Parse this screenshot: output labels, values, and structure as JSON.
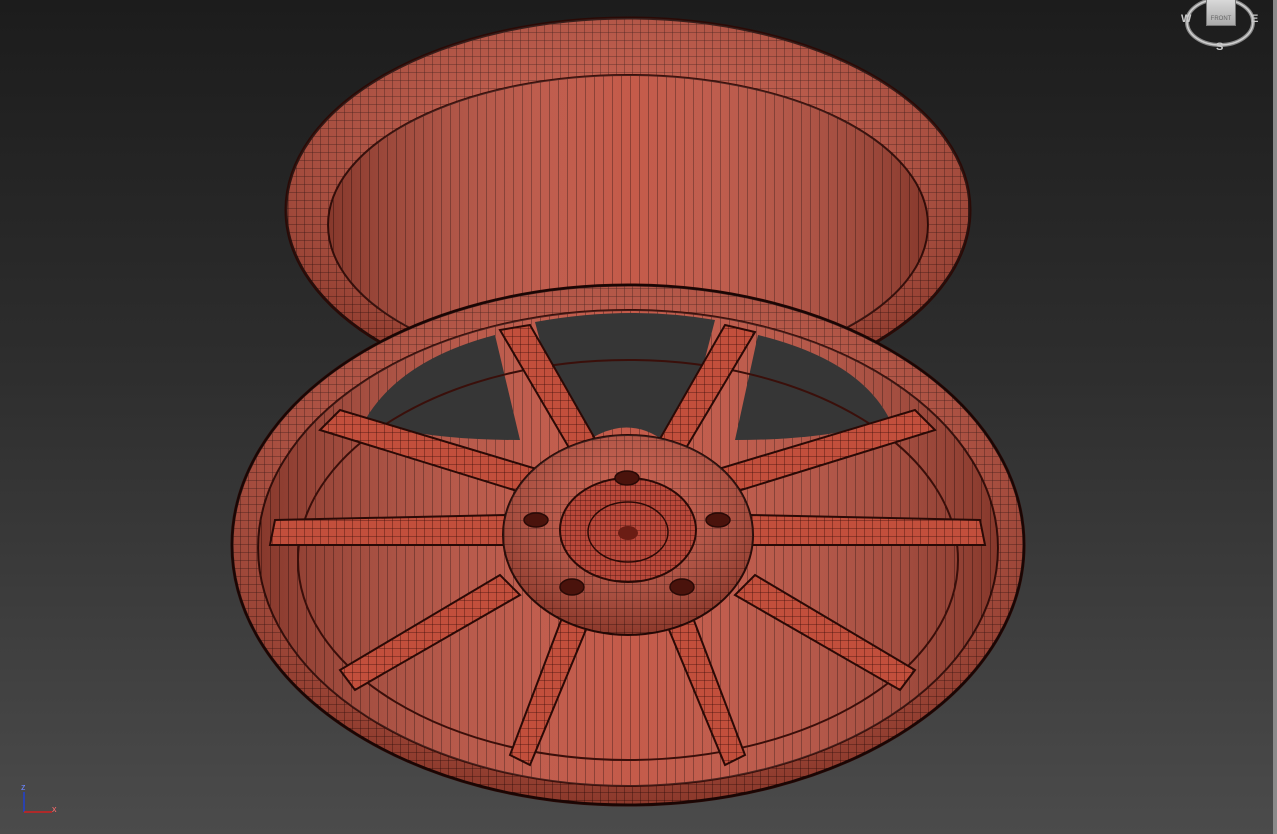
{
  "viewport": {
    "background_top": "#1c1c1c",
    "background_bottom": "#4b4b4b",
    "model": "wheel-rim-wireframe",
    "model_color": "#c0503e",
    "wire_color": "#3a0f0a"
  },
  "viewcube": {
    "face_label": "FRONT",
    "compass": {
      "west": "W",
      "east": "E",
      "south": "S"
    }
  },
  "axis_tripod": {
    "z_label": "z",
    "x_label": "x",
    "x_color": "#d02020",
    "z_color": "#2040d0"
  }
}
